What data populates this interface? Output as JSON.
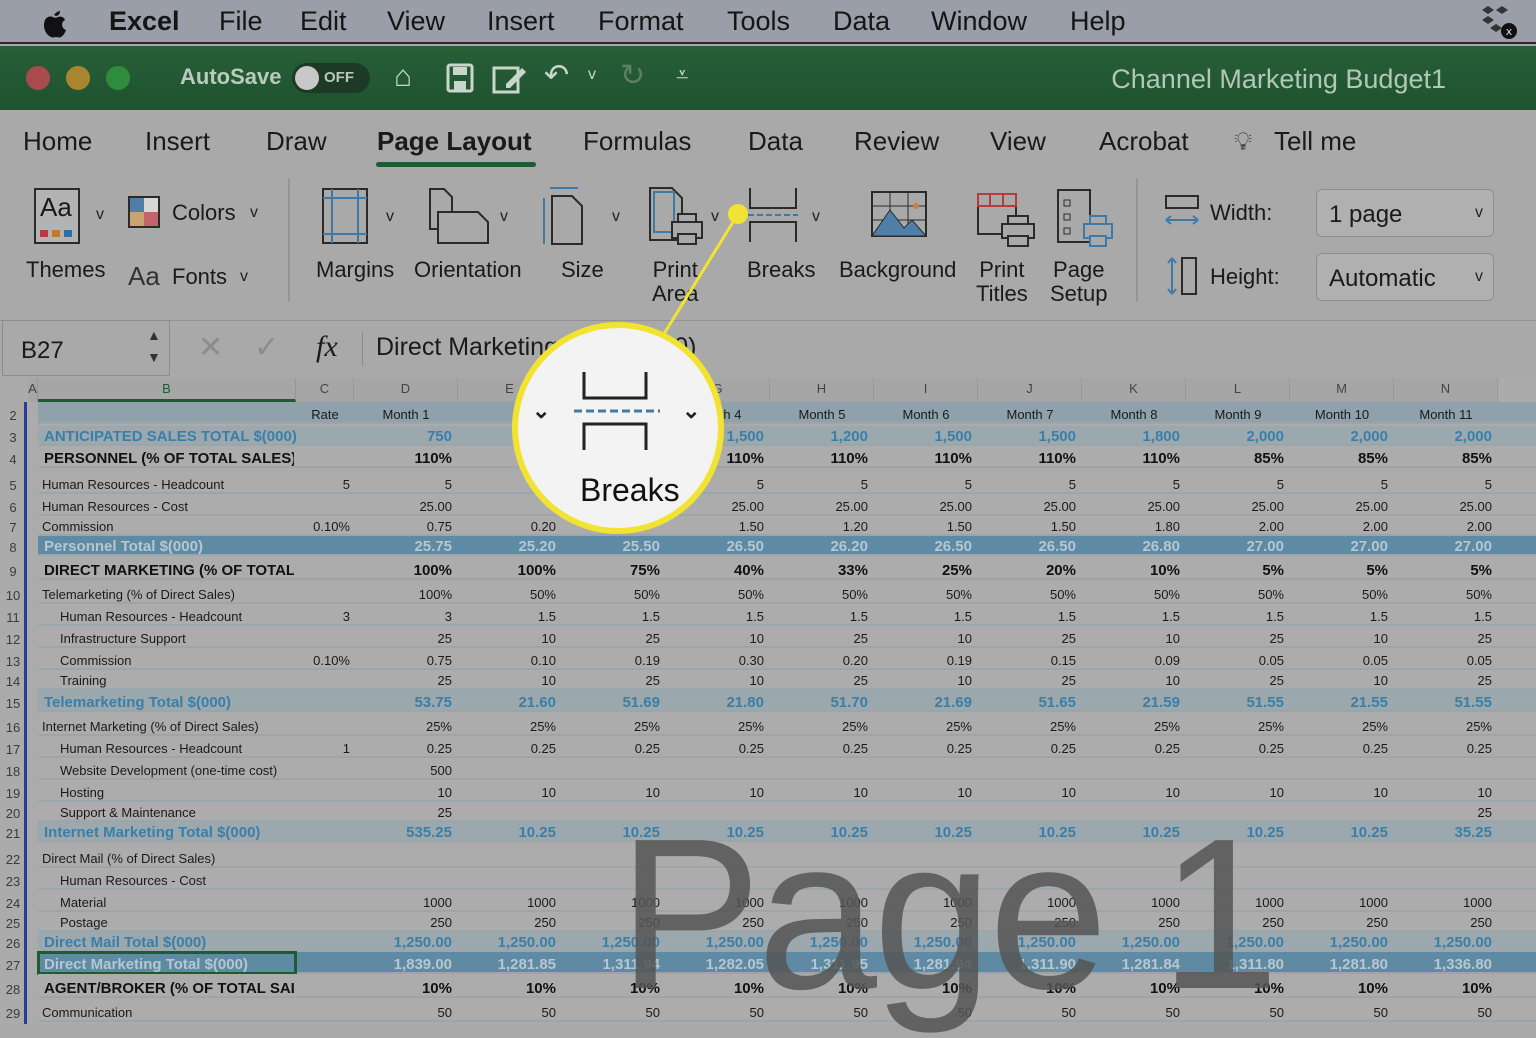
{
  "menubar": {
    "apple": "apple-logo",
    "items": [
      "Excel",
      "File",
      "Edit",
      "View",
      "Insert",
      "Format",
      "Tools",
      "Data",
      "Window",
      "Help"
    ]
  },
  "titlebar": {
    "autosave": "AutoSave",
    "toggle": "OFF",
    "title": "Channel Marketing Budget1"
  },
  "tabs": [
    "Home",
    "Insert",
    "Draw",
    "Page Layout",
    "Formulas",
    "Data",
    "Review",
    "View",
    "Acrobat",
    "Tell me"
  ],
  "active_tab": "Page Layout",
  "ribbon": {
    "themes": "Themes",
    "colors": "Colors",
    "fonts": "Fonts",
    "fonts_glyph": "Aa",
    "themes_glyph": "Aa",
    "margins": "Margins",
    "orientation": "Orientation",
    "size": "Size",
    "print_area": "Print\nArea",
    "breaks": "Breaks",
    "background": "Background",
    "print_titles": "Print\nTitles",
    "page_setup": "Page\nSetup",
    "width_label": "Width:",
    "width_value": "1 page",
    "height_label": "Height:",
    "height_value": "Automatic"
  },
  "formula": {
    "cell_ref": "B27",
    "fx": "fx",
    "content": "Direct Marketing Total $(000)"
  },
  "magnifier": {
    "label": "Breaks"
  },
  "colors": {
    "accent_green": "#1e5a33",
    "highlight_yellow": "#f2e332",
    "band_blue": "#5f8aa3",
    "section_blue_text": "#3b7ea8"
  },
  "watermark": "Page 1",
  "sheet": {
    "columns": [
      "A",
      "B",
      "C",
      "D",
      "E",
      "F",
      "G",
      "H",
      "I",
      "J",
      "K",
      "L",
      "M",
      "N"
    ],
    "rows": [
      {
        "n": "2",
        "type": "header",
        "label": "",
        "c": "Rate",
        "values": [
          "Month 1",
          "",
          "",
          "Month 4",
          "Month 5",
          "Month 6",
          "Month 7",
          "Month 8",
          "Month 9",
          "Month 10",
          "Month 11"
        ]
      },
      {
        "n": "3",
        "type": "section",
        "label": "ANTICIPATED SALES TOTAL $(000)",
        "c": "",
        "values": [
          "750",
          "",
          "",
          "1,500",
          "1,200",
          "1,500",
          "1,500",
          "1,800",
          "2,000",
          "2,000",
          "2,000"
        ]
      },
      {
        "n": "4",
        "type": "bold",
        "label": "PERSONNEL (% OF TOTAL SALES)",
        "c": "",
        "values": [
          "110%",
          "",
          "",
          "110%",
          "110%",
          "110%",
          "110%",
          "110%",
          "85%",
          "85%",
          "85%"
        ]
      },
      {
        "n": "5",
        "type": "normal",
        "label": "Human Resources - Headcount",
        "c": "5",
        "values": [
          "5",
          "",
          "",
          "5",
          "5",
          "5",
          "5",
          "5",
          "5",
          "5",
          "5"
        ]
      },
      {
        "n": "6",
        "type": "normal",
        "label": "Human Resources - Cost",
        "c": "",
        "values": [
          "25.00",
          "",
          "",
          "25.00",
          "25.00",
          "25.00",
          "25.00",
          "25.00",
          "25.00",
          "25.00",
          "25.00"
        ]
      },
      {
        "n": "7",
        "type": "normal",
        "label": "Commission",
        "c": "0.10%",
        "values": [
          "0.75",
          "0.20",
          "",
          "1.50",
          "1.20",
          "1.50",
          "1.50",
          "1.80",
          "2.00",
          "2.00",
          "2.00"
        ]
      },
      {
        "n": "8",
        "type": "band",
        "label": "Personnel Total $(000)",
        "c": "",
        "values": [
          "25.75",
          "25.20",
          "25.50",
          "26.50",
          "26.20",
          "26.50",
          "26.50",
          "26.80",
          "27.00",
          "27.00",
          "27.00"
        ]
      },
      {
        "n": "9",
        "type": "bold",
        "label": "DIRECT MARKETING (% OF TOTAL SALES)",
        "c": "",
        "values": [
          "100%",
          "100%",
          "75%",
          "40%",
          "33%",
          "25%",
          "20%",
          "10%",
          "5%",
          "5%",
          "5%"
        ]
      },
      {
        "n": "10",
        "type": "normal",
        "label": "Telemarketing (% of Direct Sales)",
        "c": "",
        "values": [
          "100%",
          "50%",
          "50%",
          "50%",
          "50%",
          "50%",
          "50%",
          "50%",
          "50%",
          "50%",
          "50%"
        ]
      },
      {
        "n": "11",
        "type": "indent",
        "label": "Human Resources - Headcount",
        "c": "3",
        "values": [
          "3",
          "1.5",
          "1.5",
          "1.5",
          "1.5",
          "1.5",
          "1.5",
          "1.5",
          "1.5",
          "1.5",
          "1.5"
        ]
      },
      {
        "n": "12",
        "type": "indent",
        "label": "Infrastructure Support",
        "c": "",
        "values": [
          "25",
          "10",
          "25",
          "10",
          "25",
          "10",
          "25",
          "10",
          "25",
          "10",
          "25"
        ]
      },
      {
        "n": "13",
        "type": "indent",
        "label": "Commission",
        "c": "0.10%",
        "values": [
          "0.75",
          "0.10",
          "0.19",
          "0.30",
          "0.20",
          "0.19",
          "0.15",
          "0.09",
          "0.05",
          "0.05",
          "0.05"
        ]
      },
      {
        "n": "14",
        "type": "indent",
        "label": "Training",
        "c": "",
        "values": [
          "25",
          "10",
          "25",
          "10",
          "25",
          "10",
          "25",
          "10",
          "25",
          "10",
          "25"
        ]
      },
      {
        "n": "15",
        "type": "section",
        "label": "Telemarketing Total $(000)",
        "c": "",
        "values": [
          "53.75",
          "21.60",
          "51.69",
          "21.80",
          "51.70",
          "21.69",
          "51.65",
          "21.59",
          "51.55",
          "21.55",
          "51.55"
        ]
      },
      {
        "n": "16",
        "type": "normal",
        "label": "Internet Marketing (% of Direct Sales)",
        "c": "",
        "values": [
          "25%",
          "25%",
          "25%",
          "25%",
          "25%",
          "25%",
          "25%",
          "25%",
          "25%",
          "25%",
          "25%"
        ]
      },
      {
        "n": "17",
        "type": "indent",
        "label": "Human Resources - Headcount",
        "c": "1",
        "values": [
          "0.25",
          "0.25",
          "0.25",
          "0.25",
          "0.25",
          "0.25",
          "0.25",
          "0.25",
          "0.25",
          "0.25",
          "0.25"
        ]
      },
      {
        "n": "18",
        "type": "indent",
        "label": "Website Development (one-time cost)",
        "c": "",
        "values": [
          "500",
          "",
          "",
          "",
          "",
          "",
          "",
          "",
          "",
          "",
          ""
        ]
      },
      {
        "n": "19",
        "type": "indent",
        "label": "Hosting",
        "c": "",
        "values": [
          "10",
          "10",
          "10",
          "10",
          "10",
          "10",
          "10",
          "10",
          "10",
          "10",
          "10"
        ]
      },
      {
        "n": "20",
        "type": "indent",
        "label": "Support & Maintenance",
        "c": "",
        "values": [
          "25",
          "",
          "",
          "",
          "",
          "",
          "",
          "",
          "",
          "",
          "25"
        ]
      },
      {
        "n": "21",
        "type": "section",
        "label": "Internet Marketing Total $(000)",
        "c": "",
        "values": [
          "535.25",
          "10.25",
          "10.25",
          "10.25",
          "10.25",
          "10.25",
          "10.25",
          "10.25",
          "10.25",
          "10.25",
          "35.25"
        ]
      },
      {
        "n": "22",
        "type": "normal",
        "label": "Direct Mail (% of Direct Sales)",
        "c": "",
        "values": [
          "",
          "",
          "",
          "",
          "",
          "",
          "",
          "",
          "",
          "",
          ""
        ]
      },
      {
        "n": "23",
        "type": "indent",
        "label": "Human Resources - Cost",
        "c": "",
        "values": [
          "",
          "",
          "",
          "",
          "",
          "",
          "",
          "",
          "",
          "",
          ""
        ]
      },
      {
        "n": "24",
        "type": "indent",
        "label": "Material",
        "c": "",
        "values": [
          "1000",
          "1000",
          "1000",
          "1000",
          "1000",
          "1000",
          "1000",
          "1000",
          "1000",
          "1000",
          "1000"
        ]
      },
      {
        "n": "25",
        "type": "indent",
        "label": "Postage",
        "c": "",
        "values": [
          "250",
          "250",
          "250",
          "250",
          "250",
          "250",
          "250",
          "250",
          "250",
          "250",
          "250"
        ]
      },
      {
        "n": "26",
        "type": "section",
        "label": "Direct Mail Total $(000)",
        "c": "",
        "values": [
          "1,250.00",
          "1,250.00",
          "1,250.00",
          "1,250.00",
          "1,250.00",
          "1,250.00",
          "1,250.00",
          "1,250.00",
          "1,250.00",
          "1,250.00",
          "1,250.00"
        ]
      },
      {
        "n": "27",
        "type": "band",
        "label": "Direct Marketing Total $(000)",
        "c": "",
        "values": [
          "1,839.00",
          "1,281.85",
          "1,311.94",
          "1,282.05",
          "1,311.95",
          "1,281.94",
          "1,311.90",
          "1,281.84",
          "1,311.80",
          "1,281.80",
          "1,336.80"
        ]
      },
      {
        "n": "28",
        "type": "bold",
        "label": "AGENT/BROKER (% OF TOTAL SALES)",
        "c": "",
        "values": [
          "10%",
          "10%",
          "10%",
          "10%",
          "10%",
          "10%",
          "10%",
          "10%",
          "10%",
          "10%",
          "10%"
        ]
      },
      {
        "n": "29",
        "type": "normal",
        "label": "Communication",
        "c": "",
        "values": [
          "50",
          "50",
          "50",
          "50",
          "50",
          "50",
          "50",
          "50",
          "50",
          "50",
          "50"
        ]
      }
    ]
  }
}
